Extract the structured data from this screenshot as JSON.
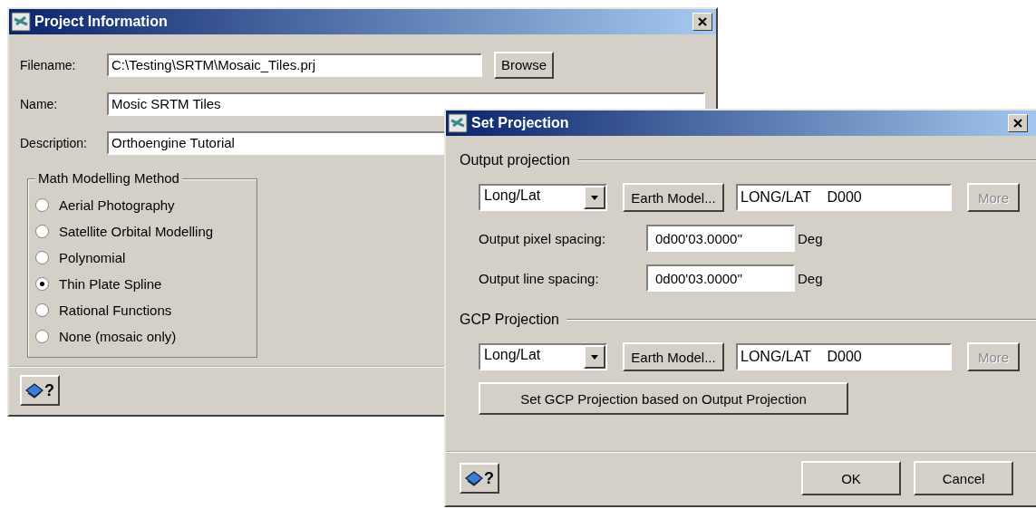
{
  "project_information": {
    "title": "Project Information",
    "fields": [
      {
        "label": "Filename:",
        "value": "C:\\Testing\\SRTM\\Mosaic_Tiles.prj",
        "kind": "browse"
      },
      {
        "label": "Name:",
        "value": "Mosic SRTM Tiles",
        "kind": "plain"
      },
      {
        "label": "Description:",
        "value": "Orthoengine Tutorial",
        "kind": "plain"
      }
    ],
    "browse_button": "Browse",
    "method_group": {
      "title": "Math Modelling Method",
      "options": [
        {
          "label": "Aerial Photography",
          "selected": false
        },
        {
          "label": "Satellite Orbital Modelling",
          "selected": false
        },
        {
          "label": "Polynomial",
          "selected": false
        },
        {
          "label": "Thin Plate Spline",
          "selected": true
        },
        {
          "label": "Rational Functions",
          "selected": false
        },
        {
          "label": "None (mosaic only)",
          "selected": false
        }
      ]
    },
    "help_button": "?"
  },
  "set_projection": {
    "title": "Set Projection",
    "sections": [
      {
        "title": "Output projection",
        "dropdown": "Long/Lat",
        "earth_model_button": "Earth Model...",
        "projection": "LONG/LAT    D000",
        "more_button": {
          "label": "More",
          "disabled": true
        },
        "spacings": [
          {
            "label": "Output pixel spacing:",
            "value": "0d00'03.0000''",
            "unit": "Deg"
          },
          {
            "label": "Output line spacing:",
            "value": "0d00'03.0000''",
            "unit": "Deg"
          }
        ]
      },
      {
        "title": "GCP Projection",
        "dropdown": "Long/Lat",
        "earth_model_button": "Earth Model...",
        "projection": "LONG/LAT    D000",
        "more_button": {
          "label": "More",
          "disabled": true
        },
        "action_button": "Set GCP Projection based on Output Projection"
      }
    ],
    "help_button": "?",
    "buttons": [
      "OK",
      "Cancel"
    ]
  }
}
